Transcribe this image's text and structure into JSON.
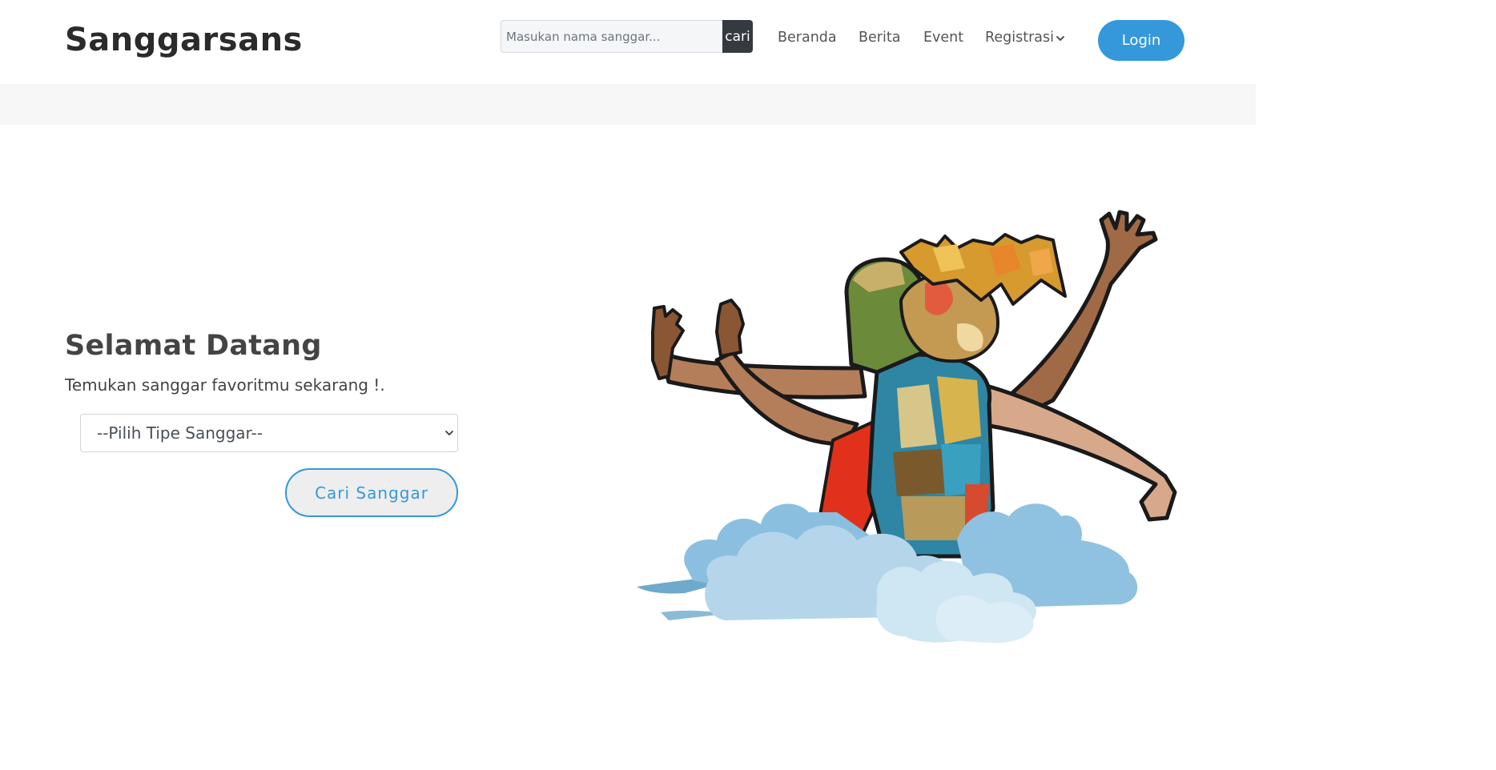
{
  "brand": "Sanggarsans",
  "search": {
    "placeholder": "Masukan nama sanggar...",
    "button_label": "cari"
  },
  "nav": {
    "items": [
      "Beranda",
      "Berita",
      "Event",
      "Registrasi"
    ],
    "login_label": "Login"
  },
  "hero": {
    "title": "Selamat Datang",
    "subtitle": "Temukan sanggar favoritmu sekarang !.",
    "select_value": "--Pilih Tipe Sanggar--",
    "submit_label": "Cari Sanggar"
  },
  "colors": {
    "accent": "#3498db",
    "dark_button": "#343a40",
    "strip": "#f7f7f7"
  },
  "icons": {
    "registrasi": "chevron-down-icon",
    "select": "chevron-down-icon",
    "illustration": "dancer-illustration"
  }
}
